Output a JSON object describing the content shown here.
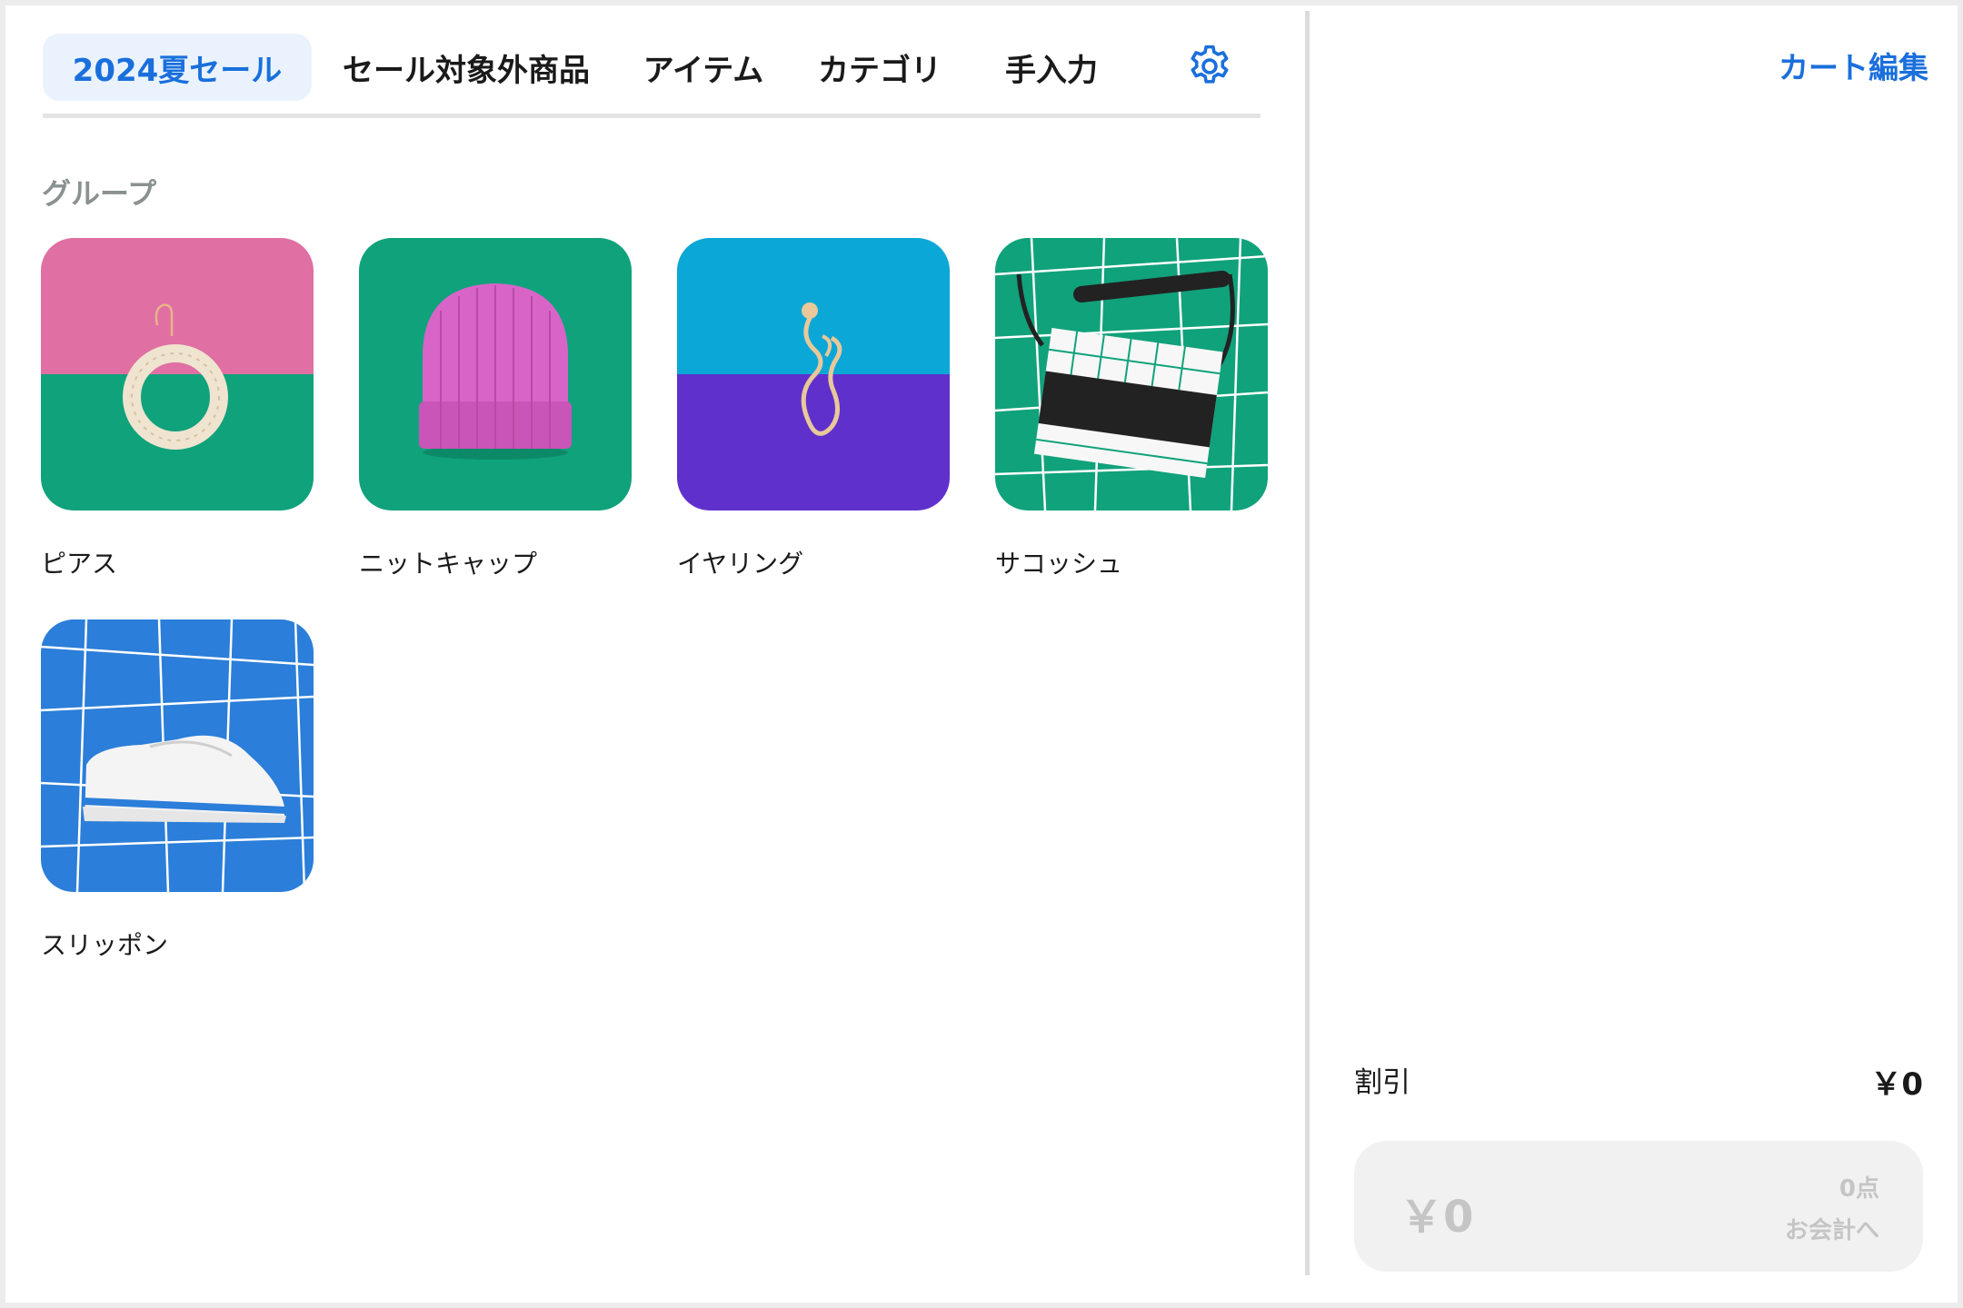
{
  "tabs": [
    {
      "label": "2024夏セール",
      "active": true
    },
    {
      "label": "セール対象外商品",
      "active": false
    },
    {
      "label": "アイテム",
      "active": false
    },
    {
      "label": "カテゴリ",
      "active": false
    },
    {
      "label": "手入力",
      "active": false
    }
  ],
  "settings_icon": "gear-icon",
  "section_title": "グループ",
  "groups": [
    {
      "label": "ピアス",
      "colors": [
        "#e06fa3",
        "#10a27b"
      ]
    },
    {
      "label": "ニットキャップ",
      "colors": [
        "#10a27b"
      ]
    },
    {
      "label": "イヤリング",
      "colors": [
        "#0ba7d6",
        "#6030cc"
      ]
    },
    {
      "label": "サコッシュ",
      "colors": [
        "#10a27b"
      ]
    },
    {
      "label": "スリッポン",
      "colors": [
        "#2b7ed9"
      ]
    }
  ],
  "cart": {
    "edit_label": "カート編集",
    "discount_label": "割引",
    "discount_value": "￥0",
    "total": "￥0",
    "count": "0点",
    "checkout_label": "お会計へ"
  },
  "colors": {
    "accent": "#1a6fdc",
    "active_tab_bg": "#eaf3fd"
  }
}
